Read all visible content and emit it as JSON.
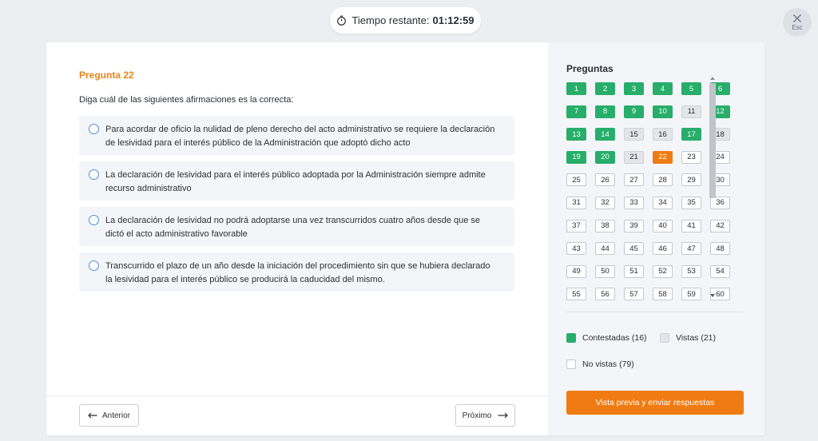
{
  "timer": {
    "label": "Tiempo restante:",
    "time": "01:12:59",
    "icon": "stopwatch-icon"
  },
  "esc": {
    "label": "Esc",
    "icon": "close-icon"
  },
  "question": {
    "title": "Pregunta 22",
    "text": "Diga cuál de las siguientes afirmaciones es la correcta:",
    "options": [
      {
        "line1": "Para acordar de oficio la nulidad de pleno derecho del acto administrativo se requiere la declaración",
        "line2": "de lesividad para el interés público de la Administración que adoptó dicho acto"
      },
      {
        "line1": "La declaración de lesividad para el interés público adoptada por la Administración siempre admite",
        "line2": "recurso administrativo"
      },
      {
        "line1": "La declaración de lesividad no podrá adoptarse una vez transcurridos cuatro años desde que se",
        "line2": "dictó el acto administrativo favorable"
      },
      {
        "line1": "Transcurrido el plazo de un año desde la iniciación del procedimiento sin que se hubiera declarado",
        "line2": "la lesividad para el interés público se producirá la caducidad del mismo."
      }
    ]
  },
  "nav": {
    "prev_label": "Anterior",
    "next_label": "Próximo"
  },
  "panel": {
    "title": "Preguntas",
    "questions": [
      {
        "n": "1",
        "state": "answered"
      },
      {
        "n": "2",
        "state": "answered"
      },
      {
        "n": "3",
        "state": "answered"
      },
      {
        "n": "4",
        "state": "answered"
      },
      {
        "n": "5",
        "state": "answered"
      },
      {
        "n": "6",
        "state": "answered"
      },
      {
        "n": "7",
        "state": "answered"
      },
      {
        "n": "8",
        "state": "answered"
      },
      {
        "n": "9",
        "state": "answered"
      },
      {
        "n": "10",
        "state": "answered"
      },
      {
        "n": "11",
        "state": "viewed"
      },
      {
        "n": "12",
        "state": "answered"
      },
      {
        "n": "13",
        "state": "answered"
      },
      {
        "n": "14",
        "state": "answered"
      },
      {
        "n": "15",
        "state": "viewed"
      },
      {
        "n": "16",
        "state": "viewed"
      },
      {
        "n": "17",
        "state": "answered"
      },
      {
        "n": "18",
        "state": "viewed"
      },
      {
        "n": "19",
        "state": "answered"
      },
      {
        "n": "20",
        "state": "answered"
      },
      {
        "n": "21",
        "state": "viewed"
      },
      {
        "n": "22",
        "state": "current"
      },
      {
        "n": "23",
        "state": "unseen"
      },
      {
        "n": "24",
        "state": "unseen"
      },
      {
        "n": "25",
        "state": "unseen"
      },
      {
        "n": "26",
        "state": "unseen"
      },
      {
        "n": "27",
        "state": "unseen"
      },
      {
        "n": "28",
        "state": "unseen"
      },
      {
        "n": "29",
        "state": "unseen"
      },
      {
        "n": "30",
        "state": "unseen"
      },
      {
        "n": "31",
        "state": "unseen"
      },
      {
        "n": "32",
        "state": "unseen"
      },
      {
        "n": "33",
        "state": "unseen"
      },
      {
        "n": "34",
        "state": "unseen"
      },
      {
        "n": "35",
        "state": "unseen"
      },
      {
        "n": "36",
        "state": "unseen"
      },
      {
        "n": "37",
        "state": "unseen"
      },
      {
        "n": "38",
        "state": "unseen"
      },
      {
        "n": "39",
        "state": "unseen"
      },
      {
        "n": "40",
        "state": "unseen"
      },
      {
        "n": "41",
        "state": "unseen"
      },
      {
        "n": "42",
        "state": "unseen"
      },
      {
        "n": "43",
        "state": "unseen"
      },
      {
        "n": "44",
        "state": "unseen"
      },
      {
        "n": "45",
        "state": "unseen"
      },
      {
        "n": "46",
        "state": "unseen"
      },
      {
        "n": "47",
        "state": "unseen"
      },
      {
        "n": "48",
        "state": "unseen"
      },
      {
        "n": "49",
        "state": "unseen"
      },
      {
        "n": "50",
        "state": "unseen"
      },
      {
        "n": "51",
        "state": "unseen"
      },
      {
        "n": "52",
        "state": "unseen"
      },
      {
        "n": "53",
        "state": "unseen"
      },
      {
        "n": "54",
        "state": "unseen"
      },
      {
        "n": "55",
        "state": "unseen"
      },
      {
        "n": "56",
        "state": "unseen"
      },
      {
        "n": "57",
        "state": "unseen"
      },
      {
        "n": "58",
        "state": "unseen"
      },
      {
        "n": "59",
        "state": "unseen"
      },
      {
        "n": "60",
        "state": "unseen"
      }
    ],
    "legend": {
      "answered": "Contestadas (16)",
      "viewed": "Vistas (21)",
      "unseen": "No vistas (79)"
    },
    "submit_label": "Vista previa y enviar respuestas"
  },
  "colors": {
    "accent_orange": "#f07b12",
    "answered_green": "#27ae6a",
    "viewed_gray": "#e3e5e8",
    "radio_blue": "#4a90d9"
  }
}
